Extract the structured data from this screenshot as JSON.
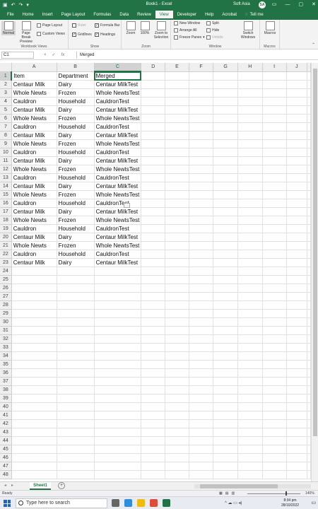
{
  "window": {
    "title": "Book1 - Excel",
    "user": "Soft Asia",
    "avatar_initials": "SA",
    "accent_color": "#217346"
  },
  "quick_access": {
    "save_icon": "save-icon",
    "undo_icon": "undo-icon",
    "redo_icon": "redo-icon",
    "customize_icon": "chevron-down-icon"
  },
  "tabs": [
    "File",
    "Home",
    "Insert",
    "Page Layout",
    "Formulas",
    "Data",
    "Review",
    "View",
    "Developer",
    "Help",
    "Acrobat"
  ],
  "active_tab": "View",
  "tell_me": "Tell me",
  "ribbon": {
    "workbook_views": {
      "label": "Workbook Views",
      "normal": "Normal",
      "page_break": "Page Break Preview",
      "page_layout": "Page Layout",
      "custom_views": "Custom Views"
    },
    "show": {
      "label": "Show",
      "ruler": "Ruler",
      "formula_bar": "Formula Bar",
      "gridlines": "Gridlines",
      "headings": "Headings",
      "ruler_checked": false,
      "formula_bar_checked": true,
      "gridlines_checked": true,
      "headings_checked": true
    },
    "zoom": {
      "label": "Zoom",
      "zoom": "Zoom",
      "hundred": "100%",
      "zoom_to_selection": "Zoom to Selection"
    },
    "window": {
      "label": "Window",
      "new_window": "New Window",
      "arrange_all": "Arrange All",
      "freeze_panes": "Freeze Panes",
      "split": "Split",
      "hide": "Hide",
      "unhide": "Unhide",
      "switch_windows": "Switch Windows"
    },
    "macros": {
      "label": "Macros",
      "macros": "Macros"
    }
  },
  "formula_bar": {
    "name_box": "C1",
    "cancel_icon": "×",
    "enter_icon": "✓",
    "fx": "fx",
    "content": "Merged"
  },
  "columns": [
    "A",
    "B",
    "C",
    "D",
    "E",
    "F",
    "G",
    "H",
    "I",
    "J"
  ],
  "selected_column": "C",
  "selected_row": 1,
  "total_rows": 48,
  "cells": [
    [
      "Item",
      "Department",
      "Merged"
    ],
    [
      "Centaur Milk",
      "Dairy",
      "Centaur MilkTest"
    ],
    [
      "Whole Newts",
      "Frozen",
      "Whole NewtsTest"
    ],
    [
      "Cauldron",
      "Household",
      "CauldronTest"
    ],
    [
      "Centaur Milk",
      "Dairy",
      "Centaur MilkTest"
    ],
    [
      "Whole Newts",
      "Frozen",
      "Whole NewtsTest"
    ],
    [
      "Cauldron",
      "Household",
      "CauldronTest"
    ],
    [
      "Centaur Milk",
      "Dairy",
      "Centaur MilkTest"
    ],
    [
      "Whole Newts",
      "Frozen",
      "Whole NewtsTest"
    ],
    [
      "Cauldron",
      "Household",
      "CauldronTest"
    ],
    [
      "Centaur Milk",
      "Dairy",
      "Centaur MilkTest"
    ],
    [
      "Whole Newts",
      "Frozen",
      "Whole NewtsTest"
    ],
    [
      "Cauldron",
      "Household",
      "CauldronTest"
    ],
    [
      "Centaur Milk",
      "Dairy",
      "Centaur MilkTest"
    ],
    [
      "Whole Newts",
      "Frozen",
      "Whole NewtsTest"
    ],
    [
      "Cauldron",
      "Household",
      "CauldronTest"
    ],
    [
      "Centaur Milk",
      "Dairy",
      "Centaur MilkTest"
    ],
    [
      "Whole Newts",
      "Frozen",
      "Whole NewtsTest"
    ],
    [
      "Cauldron",
      "Household",
      "CauldronTest"
    ],
    [
      "Centaur Milk",
      "Dairy",
      "Centaur MilkTest"
    ],
    [
      "Whole Newts",
      "Frozen",
      "Whole NewtsTest"
    ],
    [
      "Cauldron",
      "Household",
      "CauldronTest"
    ],
    [
      "Centaur Milk",
      "Dairy",
      "Centaur MilkTest"
    ]
  ],
  "sheet_tabs": [
    "Sheet1"
  ],
  "status": {
    "ready": "Ready",
    "zoom": "140%"
  },
  "taskbar": {
    "search_placeholder": "Type here to search",
    "time": "8:34 pm",
    "date": "28/10/2022",
    "tray": "^  ☁  ▭  ◂)"
  }
}
